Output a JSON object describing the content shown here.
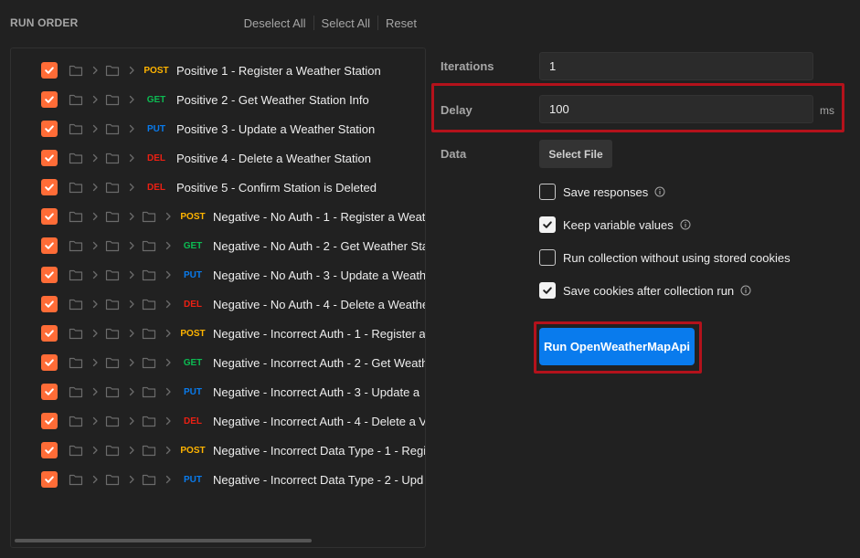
{
  "header": {
    "title": "RUN ORDER",
    "actions": [
      "Deselect All",
      "Select All",
      "Reset"
    ]
  },
  "requests": [
    {
      "method": "POST",
      "name": "Positive 1 - Register a Weather Station",
      "checked": true
    },
    {
      "method": "GET",
      "name": "Positive 2 - Get Weather Station Info",
      "checked": true
    },
    {
      "method": "PUT",
      "name": "Positive 3 - Update a Weather Station",
      "checked": true
    },
    {
      "method": "DEL",
      "name": "Positive 4 - Delete a Weather Station",
      "checked": true
    },
    {
      "method": "DEL",
      "name": "Positive 5 - Confirm Station is Deleted",
      "checked": true
    },
    {
      "method": "POST",
      "name": "Negative - No Auth - 1 - Register a Weath",
      "checked": true
    },
    {
      "method": "GET",
      "name": "Negative - No Auth - 2 - Get Weather Sta",
      "checked": true
    },
    {
      "method": "PUT",
      "name": "Negative - No Auth - 3 - Update a Weath",
      "checked": true
    },
    {
      "method": "DEL",
      "name": "Negative - No Auth - 4 - Delete a Weathe",
      "checked": true
    },
    {
      "method": "POST",
      "name": "Negative - Incorrect Auth - 1 - Register a",
      "checked": true
    },
    {
      "method": "GET",
      "name": "Negative - Incorrect Auth - 2 - Get Weath",
      "checked": true
    },
    {
      "method": "PUT",
      "name": "Negative - Incorrect Auth - 3 - Update a",
      "checked": true
    },
    {
      "method": "DEL",
      "name": "Negative - Incorrect Auth - 4 - Delete a V",
      "checked": true
    },
    {
      "method": "POST",
      "name": "Negative - Incorrect Data Type - 1 - Regis",
      "checked": true
    },
    {
      "method": "PUT",
      "name": "Negative - Incorrect Data Type - 2 - Upd",
      "checked": true
    }
  ],
  "settings": {
    "iterations_label": "Iterations",
    "iterations_value": "1",
    "delay_label": "Delay",
    "delay_value": "100",
    "delay_unit": "ms",
    "data_label": "Data",
    "select_file_label": "Select File",
    "options": [
      {
        "label": "Save responses",
        "checked": false,
        "info": true
      },
      {
        "label": "Keep variable values",
        "checked": true,
        "info": true
      },
      {
        "label": "Run collection without using stored cookies",
        "checked": false,
        "info": false
      },
      {
        "label": "Save cookies after collection run",
        "checked": true,
        "info": true
      }
    ],
    "run_button_label": "Run OpenWeatherMapApi"
  },
  "colors": {
    "accent": "#ff6c37",
    "run_button": "#097bed",
    "highlight": "#b4121b",
    "post": "#ffb400",
    "get": "#0cbb52",
    "put": "#097bed",
    "del": "#eb2013"
  }
}
